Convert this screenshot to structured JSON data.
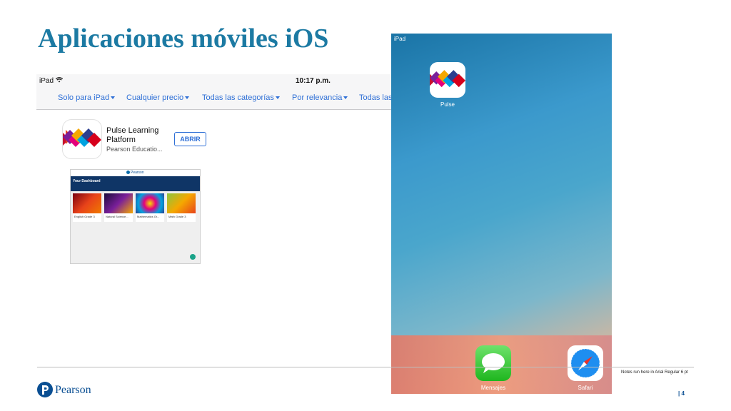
{
  "slide": {
    "title": "Aplicaciones móviles iOS",
    "notes": "Notes run here in Arial Regular 6 pt",
    "page_number": "| 4",
    "brand": "Pearson"
  },
  "app_store": {
    "status": {
      "carrier": "iPad",
      "time": "10:17 p.m."
    },
    "filters": [
      "Solo para iPad",
      "Cualquier precio",
      "Todas las categorías",
      "Por relevancia",
      "Todas las"
    ],
    "result": {
      "name": "Pulse Learning Platform",
      "developer": "Pearson Educatio...",
      "action": "ABRIR",
      "action_prefix": "+"
    },
    "preview": {
      "brand": "Pearson",
      "heading": "Your Dashboard",
      "cards": [
        "English Grade 3",
        "Natural Science...",
        "Mathematics Gr...",
        "Math Grade 3"
      ]
    }
  },
  "home_screen": {
    "status": "iPad",
    "apps": [
      {
        "label": "Pulse",
        "icon": "pulse-app-icon"
      }
    ],
    "dock": [
      {
        "label": "Mensajes",
        "icon": "messages-app-icon"
      },
      {
        "label": "Safari",
        "icon": "safari-app-icon"
      }
    ]
  },
  "colors": {
    "title": "#1c7aa3",
    "ios_link": "#2e6fd6",
    "pearson_blue": "#0a4f93"
  }
}
